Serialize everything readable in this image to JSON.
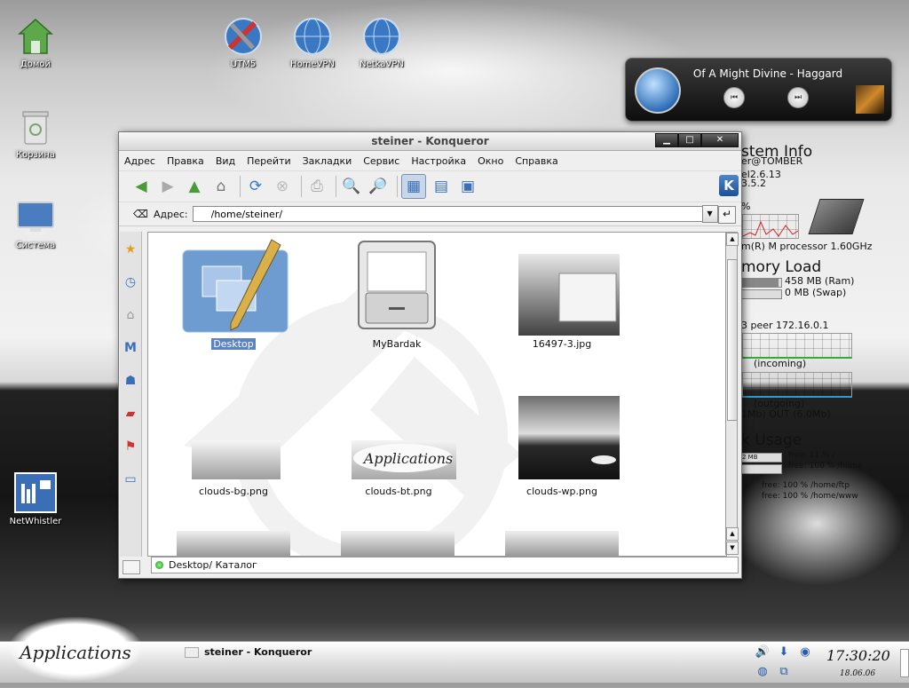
{
  "desktop": {
    "icons": [
      {
        "label": "Домой",
        "icon": "home-icon"
      },
      {
        "label": "Корзина",
        "icon": "trash-icon"
      },
      {
        "label": "Система",
        "icon": "monitor-icon"
      },
      {
        "label": "NetWhistler",
        "icon": "network-icon"
      },
      {
        "label": "UTM5",
        "icon": "tools-globe-icon"
      },
      {
        "label": "HomeVPN",
        "icon": "globe-icon"
      },
      {
        "label": "NetkaVPN",
        "icon": "globe-icon"
      }
    ]
  },
  "player": {
    "track": "Of A Might Divine - Haggard",
    "prev_glyph": "⏮",
    "next_glyph": "⏭"
  },
  "sysinfo": {
    "title": "stem Info",
    "user": "er@TOMBER",
    "kernel": "el2.6.13",
    "kde": "3.5.2",
    "pct": "%",
    "cpu": "m(R) M processor 1.60GHz",
    "mem_title": "mory Load",
    "ram": "458 MB (Ram)",
    "swap": "0 MB (Swap)",
    "ram_used": 0.93,
    "swap_used": 0.0,
    "peer": "3 peer 172.16.0.1",
    "incoming": "(incoming)",
    "outgoing": "(outgoing)",
    "traffic": "1Mb)  OUT   (6.0Mb)",
    "disk_title": "k Usage",
    "disk_bar_label": "2 MB",
    "disks": [
      "free:  11 % /",
      "free:  100 % /home",
      "free:  100 % /home/ftp",
      "free:  100 % /home/www"
    ]
  },
  "window": {
    "title": "steiner - Konqueror",
    "controls": {
      "minimize": "▁",
      "maximize": "□",
      "close": "✕"
    },
    "menu": [
      "Адрес",
      "Правка",
      "Вид",
      "Перейти",
      "Закладки",
      "Сервис",
      "Настройка",
      "Окно",
      "Справка"
    ],
    "kde_logo": "K",
    "location_label": "Адрес:",
    "location_value": "/home/steiner/",
    "files": [
      {
        "name": "Desktop",
        "selected": true
      },
      {
        "name": "MyBardak",
        "selected": false
      },
      {
        "name": "16497-3.jpg",
        "selected": false
      },
      {
        "name": "clouds-bg.png",
        "selected": false
      },
      {
        "name": "clouds-bt.png",
        "selected": false
      },
      {
        "name": "clouds-wp.png",
        "selected": false
      }
    ],
    "status": "Desktop/  Каталог"
  },
  "taskbar": {
    "apps_label": "Applications",
    "task": "steiner - Konqueror",
    "clock": "17:30:20",
    "date": "18.06.06"
  }
}
